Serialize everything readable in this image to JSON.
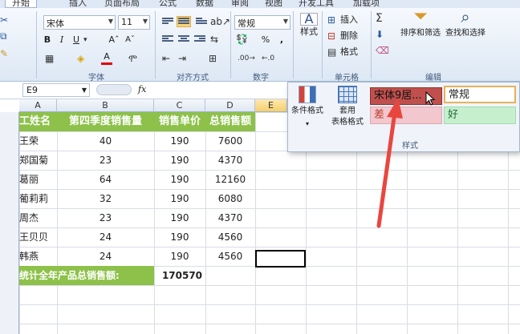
{
  "tabs": [
    "开始",
    "插入",
    "页面布局",
    "公式",
    "数据",
    "审阅",
    "视图",
    "开发工具",
    "加载项"
  ],
  "ribbon": {
    "font_name": "宋体",
    "font_size": "11",
    "font_label": "字体",
    "align_label": "对齐方式",
    "number_format": "常规",
    "number_label": "数字",
    "styles_button": "样式",
    "insert": "插入",
    "delete": "删除",
    "format": "格式",
    "cells_label": "单元格",
    "sort_filter": "排序和筛选",
    "find_select": "查找和选择",
    "edit_label": "编辑"
  },
  "formula_bar": {
    "name_box": "E9",
    "fx": "fx"
  },
  "columns": [
    "A",
    "B",
    "C",
    "D",
    "E"
  ],
  "headers": [
    "工姓名",
    "第四季度销售量",
    "销售单价",
    "总销售额"
  ],
  "rows": [
    [
      "王荣",
      "40",
      "190",
      "7600"
    ],
    [
      "郑国菊",
      "23",
      "190",
      "4370"
    ],
    [
      "葛丽",
      "64",
      "190",
      "12160"
    ],
    [
      "葡莉莉",
      "32",
      "190",
      "6080"
    ],
    [
      "周杰",
      "23",
      "190",
      "4370"
    ],
    [
      "王贝贝",
      "24",
      "190",
      "4560"
    ],
    [
      "韩燕",
      "24",
      "190",
      "4560"
    ]
  ],
  "total": {
    "label": "统计全年产品总销售额:",
    "value": "170570"
  },
  "style_panel": {
    "conditional": "条件格式",
    "table_format_1": "套用",
    "table_format_2": "表格格式",
    "style_hover": "宋体9居...",
    "style_normal": "常规",
    "style_bad": "差",
    "style_good": "好",
    "group_label": "样式"
  },
  "colors": {
    "header_green": "#8dc14a",
    "bad_fill": "#f2c7ce",
    "good_fill": "#c6efce",
    "hover_fill": "#c0504d",
    "arrow_red": "#e8473f"
  }
}
